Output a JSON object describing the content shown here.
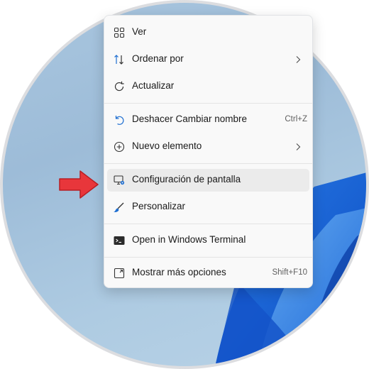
{
  "context_menu": {
    "items": [
      {
        "label": "Ver",
        "icon": "view-grid-icon"
      },
      {
        "label": "Ordenar por",
        "icon": "sort-icon",
        "submenu": true
      },
      {
        "label": "Actualizar",
        "icon": "refresh-icon"
      },
      {
        "label": "Deshacer Cambiar nombre",
        "icon": "undo-icon",
        "shortcut": "Ctrl+Z"
      },
      {
        "label": "Nuevo elemento",
        "icon": "new-item-icon",
        "submenu": true
      },
      {
        "label": "Configuración de pantalla",
        "icon": "display-settings-icon",
        "highlighted": true
      },
      {
        "label": "Personalizar",
        "icon": "brush-icon"
      },
      {
        "label": "Open in Windows Terminal",
        "icon": "terminal-icon"
      },
      {
        "label": "Mostrar más opciones",
        "icon": "more-options-icon",
        "shortcut": "Shift+F10"
      }
    ]
  },
  "colors": {
    "accent": "#1f6fd1",
    "arrow": "#e8363b",
    "menu_bg": "#f9f9f9",
    "hover_bg": "#ebebeb"
  }
}
